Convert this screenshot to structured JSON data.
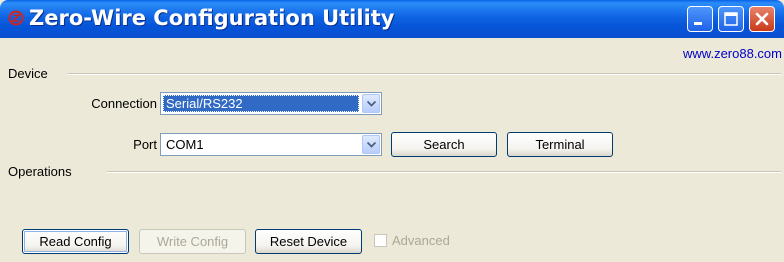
{
  "window": {
    "title": "Zero-Wire Configuration Utility"
  },
  "header": {
    "link_text": "www.zero88.com"
  },
  "device": {
    "group_label": "Device",
    "connection_label": "Connection",
    "connection_value": "Serial/RS232",
    "port_label": "Port",
    "port_value": "COM1",
    "search_label": "Search",
    "terminal_label": "Terminal"
  },
  "operations": {
    "group_label": "Operations",
    "read_config_label": "Read Config",
    "write_config_label": "Write Config",
    "write_config_enabled": false,
    "reset_device_label": "Reset Device",
    "advanced_label": "Advanced",
    "advanced_checked": false,
    "advanced_enabled": false
  },
  "colors": {
    "titlebar": "#0654d8",
    "link": "#0000c8",
    "selection": "#316ac5",
    "disabled_text": "#aca899",
    "close_button": "#c8391a"
  },
  "icons": {
    "app": "zero88-logo-icon",
    "minimize": "minimize-icon",
    "maximize": "maximize-icon",
    "close": "close-icon",
    "dropdown": "chevron-down-icon"
  }
}
